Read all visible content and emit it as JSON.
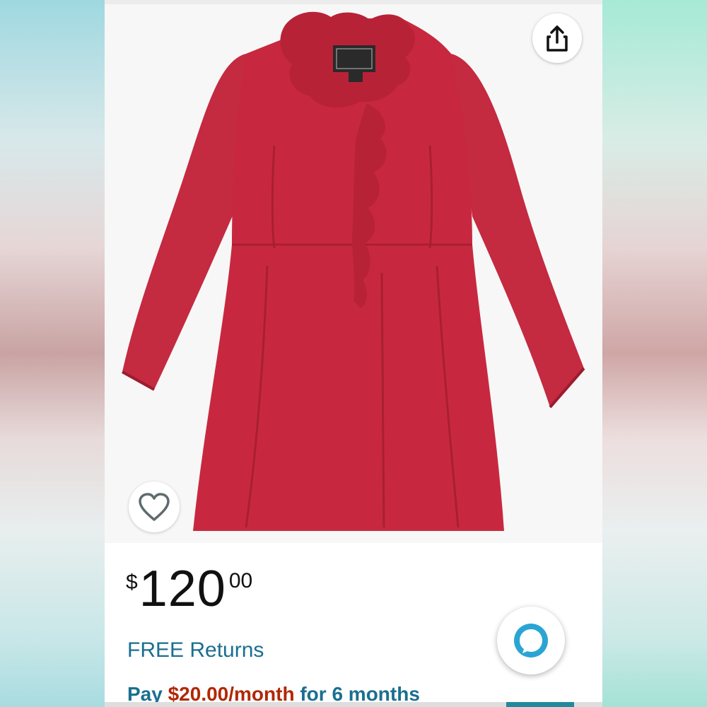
{
  "product": {
    "price_symbol": "$",
    "price_whole": "120",
    "price_fraction": "00",
    "free_returns": "FREE Returns",
    "installment_prefix": "Pay ",
    "installment_amount": "$20.00/month",
    "installment_suffix": " for 6 months"
  },
  "icons": {
    "share": "share-icon",
    "wishlist": "heart-outline-icon",
    "assistant": "alexa-icon"
  },
  "colors": {
    "coat": "#c8283f",
    "link": "#1a6f8f",
    "alexa": "#2aa5d3"
  }
}
